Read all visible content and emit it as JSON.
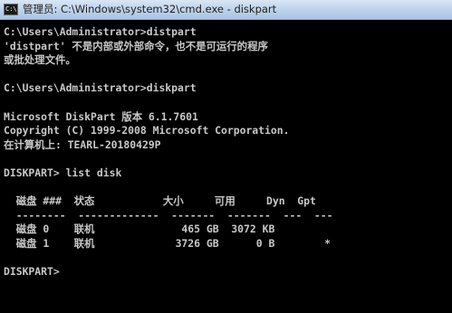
{
  "window": {
    "title": "管理员: C:\\Windows\\system32\\cmd.exe - diskpart",
    "icon_label": "C:\\",
    "icon": "console-window-icon"
  },
  "colors": {
    "console_bg": "#000000",
    "console_text": "#c8c8c8",
    "titlebar": "#bcd2ea"
  },
  "console": {
    "lines": [
      "C:\\Users\\Administrator>distpart",
      "'distpart' 不是内部或外部命令，也不是可运行的程序",
      "或批处理文件。",
      "",
      "C:\\Users\\Administrator>diskpart",
      "",
      "Microsoft DiskPart 版本 6.1.7601",
      "Copyright (C) 1999-2008 Microsoft Corporation.",
      "在计算机上: TEARL-20180429P",
      "",
      "DISKPART> list disk",
      "",
      "  磁盘 ###  状态           大小     可用     Dyn  Gpt",
      "  --------  -------------  -------  -------  ---  ---",
      "  磁盘 0    联机              465 GB  3072 KB",
      "  磁盘 1    联机             3726 GB      0 B        *",
      "",
      "DISKPART>"
    ]
  }
}
